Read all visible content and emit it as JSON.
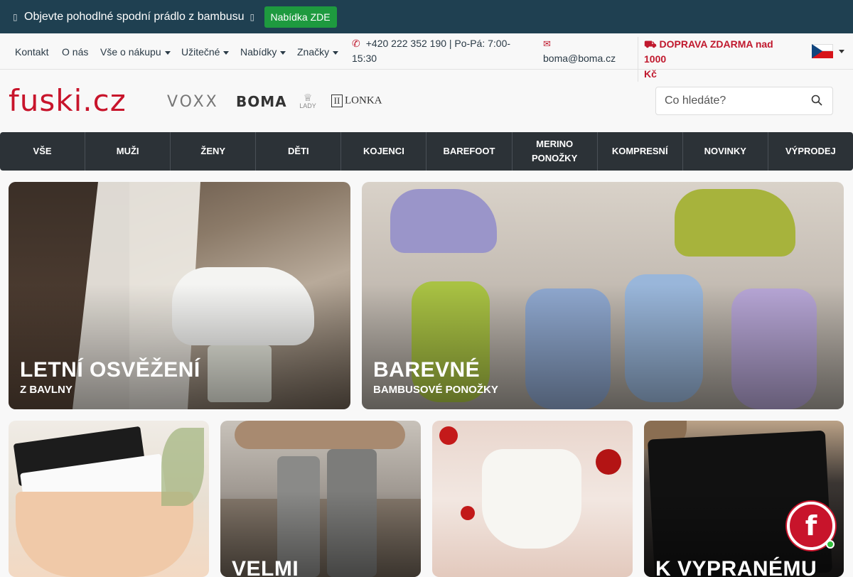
{
  "promo": {
    "text": "Objevte pohodlné spodní prádlo z bambusu",
    "button": "Nabídka ZDE"
  },
  "subnav": {
    "links": [
      {
        "label": "Kontakt",
        "dropdown": false
      },
      {
        "label": "O nás",
        "dropdown": false
      },
      {
        "label": "Vše o nákupu",
        "dropdown": true
      },
      {
        "label": "Užitečné",
        "dropdown": true
      },
      {
        "label": "Nabídky",
        "dropdown": true
      },
      {
        "label": "Značky",
        "dropdown": true
      }
    ],
    "phone_line1": "+420 222 352 190 | Po-Pá: 7:00-",
    "phone_line2": "15:30",
    "email": "boma@boma.cz",
    "shipping_line1": "DOPRAVA ZDARMA nad 1000",
    "shipping_line2": "Kč",
    "language": "cs"
  },
  "header": {
    "logo": "fuski.cz",
    "brands": [
      "VOXX",
      "BOMA",
      "LADY",
      "LONKA"
    ],
    "brand_texts": {
      "voxx": "VOXX",
      "boma": "BOMA",
      "lady": "LADY",
      "lonka": "LONKA"
    },
    "search_placeholder": "Co hledáte?"
  },
  "categories": [
    "VŠE",
    "MUŽI",
    "ŽENY",
    "DĚTI",
    "KOJENCI",
    "BAREFOOT",
    "MERINO PONOŽKY",
    "KOMPRESNÍ",
    "NOVINKY",
    "VÝPRODEJ"
  ],
  "banners": [
    {
      "title": "LETNÍ OSVĚŽENÍ",
      "subtitle": "Z BAVLNY"
    },
    {
      "title": "BAREVNÉ",
      "subtitle": "BAMBUSOVÉ PONOŽKY"
    },
    {
      "title": "",
      "subtitle": ""
    },
    {
      "title": "VELMI",
      "subtitle": ""
    },
    {
      "title": "",
      "subtitle": ""
    },
    {
      "title": "K VYPRANÉMU",
      "subtitle": ""
    }
  ],
  "chat_widget": {
    "letter": "f"
  },
  "colors": {
    "brand_red": "#c8142b",
    "promo_bg": "#1f4051",
    "promo_button": "#1e9a3f",
    "nav_dark": "#2c3237"
  }
}
